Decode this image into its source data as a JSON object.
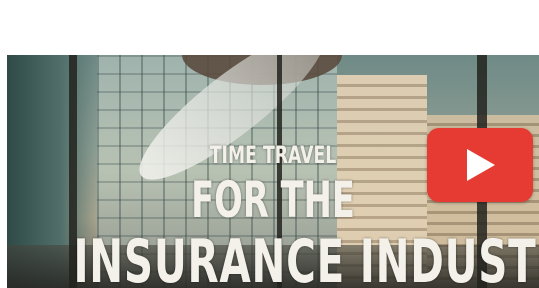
{
  "video": {
    "title_line1": "TIME TRAVEL",
    "title_line2": "FOR THE",
    "title_line3": "INSURANCE INDUSTRY",
    "play_icon": "play-icon",
    "colors": {
      "play_button": "#e63b33",
      "title_text": "#f4f1ea"
    }
  }
}
